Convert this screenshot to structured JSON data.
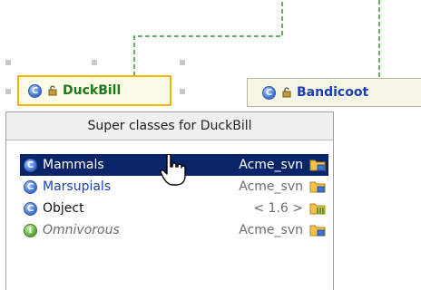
{
  "diagram": {
    "nodes": {
      "duckbill": {
        "badge": "C",
        "name": "DuckBill"
      },
      "bandicoot": {
        "badge": "C",
        "name": "Bandicoot"
      }
    }
  },
  "popup": {
    "title": "Super classes for DuckBill",
    "rows": [
      {
        "badge": "C",
        "name": "Mammals",
        "repo": "Acme_svn",
        "icon": "svn-folder-icon",
        "selected": true
      },
      {
        "badge": "C",
        "name": "Marsupials",
        "repo": "Acme_svn",
        "icon": "svn-folder-icon",
        "selected": false
      },
      {
        "badge": "C",
        "name": "Object",
        "repo": "< 1.6 >",
        "icon": "library-folder-icon",
        "selected": false
      },
      {
        "badge": "I",
        "name": "Omnivorous",
        "repo": "Acme_svn",
        "icon": "svn-folder-icon",
        "selected": false
      }
    ]
  },
  "colors": {
    "selection": "#0a246a",
    "node_border": "#f2b600",
    "edge": "#2a9a2a"
  }
}
